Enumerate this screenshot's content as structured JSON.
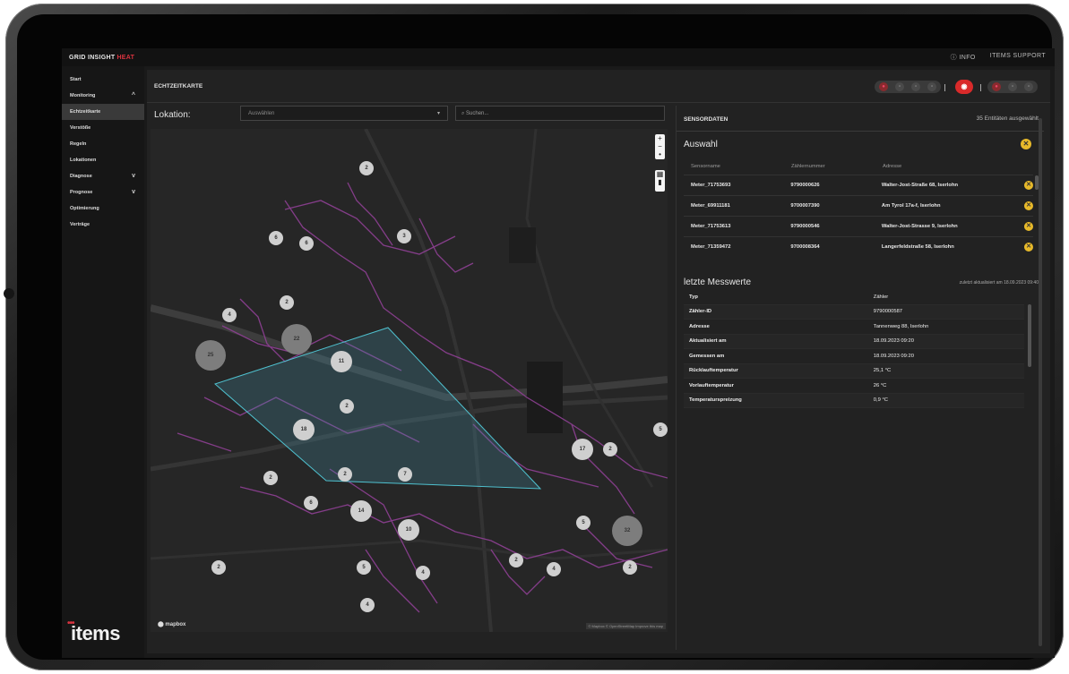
{
  "app": {
    "brand": "GRID INSIGHT",
    "brand_accent": "HEAT",
    "accent_color": "#d9333f"
  },
  "topbar": {
    "info": "ⓘ INFO",
    "support": "ITEMS SUPPORT"
  },
  "sidebar": {
    "items": [
      {
        "label": "Start"
      },
      {
        "label": "Monitoring",
        "chevron": "^"
      },
      {
        "label": "Echtzeitkarte",
        "active": true
      },
      {
        "label": "Verstöße"
      },
      {
        "label": "Regeln"
      },
      {
        "label": "Lokationen"
      },
      {
        "label": "Diagnose",
        "chevron": "v"
      },
      {
        "label": "Prognose",
        "chevron": "v"
      },
      {
        "label": "Optimierung"
      },
      {
        "label": "Verträge"
      }
    ],
    "logo": "items"
  },
  "page": {
    "title": "ECHTZEITKARTE"
  },
  "filters": {
    "location_label": "Lokation:",
    "select_placeholder": "Auswählen",
    "search_placeholder": "Suchen..."
  },
  "map": {
    "clusters": [
      "2",
      "6",
      "6",
      "3",
      "4",
      "2",
      "22",
      "25",
      "11",
      "2",
      "18",
      "2",
      "7",
      "2",
      "6",
      "14",
      "10",
      "2",
      "5",
      "4",
      "17",
      "2",
      "5",
      "32",
      "2",
      "2",
      "4",
      "5",
      "4"
    ],
    "controls": {
      "zoom_in": "+",
      "zoom_out": "−",
      "compass": "•"
    },
    "attribution_logo": "mapbox",
    "attribution_text": "© Mapbox © OpenStreetMap  Improve this map"
  },
  "sensordaten": {
    "title": "SENSORDATEN",
    "count": "35 Entitäten ausgewählt",
    "auswahl_title": "Auswahl",
    "columns": [
      "Sensorname",
      "Zählernummer",
      "Adresse"
    ],
    "rows": [
      {
        "name": "Meter_71753693",
        "number": "9790000626",
        "address": "Walter-Jost-Straße 68, Iserlohn"
      },
      {
        "name": "Meter_69911181",
        "number": "9700007390",
        "address": "Am Tyrol 17a-f, Iserlohn"
      },
      {
        "name": "Meter_71753613",
        "number": "9790000546",
        "address": "Walter-Jost-Strasse 9, Iserlohn"
      },
      {
        "name": "Meter_71359472",
        "number": "9700008364",
        "address": "Langerfeldstraße 58, Iserlohn"
      }
    ],
    "last_values_title": "letzte Messwerte",
    "last_updated": "zuletzt aktualisiert am 18.09.2023 09:40",
    "values": [
      {
        "k": "Typ",
        "v": "Zähler"
      },
      {
        "k": "Zähler-ID",
        "v": "9790000587"
      },
      {
        "k": "Adresse",
        "v": "Tannenweg 88, Iserlohn"
      },
      {
        "k": "Aktualisiert am",
        "v": "18.09.2023 09:20"
      },
      {
        "k": "Gemessen am",
        "v": "18.09.2023 09:20"
      },
      {
        "k": "Rücklauftemperatur",
        "v": "25,1 °C"
      },
      {
        "k": "Vorlauftemperatur",
        "v": "26 °C"
      },
      {
        "k": "Temperaturspreizung",
        "v": "0,9 °C"
      }
    ]
  }
}
